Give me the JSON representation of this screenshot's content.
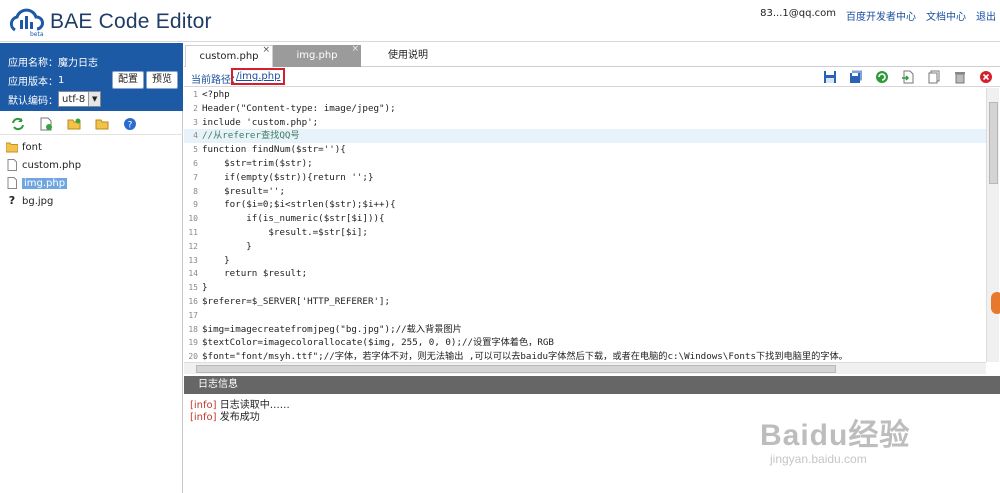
{
  "header": {
    "brand": "BAE Code Editor",
    "logo_tag": "beta",
    "user": "83...1@qq.com",
    "links": [
      "百度开发者中心",
      "文档中心",
      "退出"
    ]
  },
  "app": {
    "name_label": "应用名称：",
    "name_value": "魔力日志",
    "version_label": "应用版本：",
    "version_value": "1",
    "encoding_label": "默认编码：",
    "encoding_value": "utf-8",
    "config_button": "配置",
    "preview_button": "预览"
  },
  "file_tools": [
    "refresh-icon",
    "new-file-icon",
    "new-folder-icon",
    "open-folder-icon",
    "help-icon"
  ],
  "tree": [
    {
      "name": "font",
      "type": "folder"
    },
    {
      "name": "custom.php",
      "type": "file"
    },
    {
      "name": "img.php",
      "type": "file",
      "selected": true
    },
    {
      "name": "bg.jpg",
      "type": "unknown"
    }
  ],
  "tabs": [
    {
      "label": "custom.php"
    },
    {
      "label": "img.php"
    },
    {
      "label": "使用说明"
    }
  ],
  "path": {
    "label": "当前路径：",
    "value": "/img.php"
  },
  "path_tools": [
    "save-icon",
    "save-all-icon",
    "refresh-icon",
    "export-icon",
    "copy-icon",
    "delete-icon",
    "close-icon"
  ],
  "code": {
    "lines": [
      {
        "n": "1",
        "t": "<?php"
      },
      {
        "n": "2",
        "t": "Header(\"Content-type: image/jpeg\");"
      },
      {
        "n": "3",
        "t": "include 'custom.php';"
      },
      {
        "n": "4",
        "t": "//从referer查找QQ号"
      },
      {
        "n": "5",
        "t": "function findNum($str=''){"
      },
      {
        "n": "6",
        "t": "    $str=trim($str);"
      },
      {
        "n": "7",
        "t": "    if(empty($str)){return '';}"
      },
      {
        "n": "8",
        "t": "    $result='';"
      },
      {
        "n": "9",
        "t": "    for($i=0;$i<strlen($str);$i++){"
      },
      {
        "n": "10",
        "t": "        if(is_numeric($str[$i])){"
      },
      {
        "n": "11",
        "t": "            $result.=$str[$i];"
      },
      {
        "n": "12",
        "t": "        }"
      },
      {
        "n": "13",
        "t": "    }"
      },
      {
        "n": "14",
        "t": "    return $result;"
      },
      {
        "n": "15",
        "t": "}"
      },
      {
        "n": "16",
        "t": "$referer=$_SERVER['HTTP_REFERER'];"
      },
      {
        "n": "17",
        "t": ""
      },
      {
        "n": "18",
        "t": "$img=imagecreatefromjpeg(\"bg.jpg\");//载入背景图片"
      },
      {
        "n": "19",
        "t": "$textColor=imagecolorallocate($img, 255, 0, 0);//设置字体着色，RGB"
      },
      {
        "n": "20",
        "t": "$font=\"font/msyh.ttf\";//字体，若字体不对，则无法输出 ,可以可以去baidu字体然后下载，或者在电脑的c:\\Windows\\Fonts下找到电脑里的字体。"
      }
    ]
  },
  "log": {
    "title": "日志信息",
    "entries": [
      {
        "tag": "[info]",
        "text": "日志读取中……"
      },
      {
        "tag": "[info]",
        "text": "发布成功"
      }
    ]
  },
  "watermark": {
    "main": "Baidu经验",
    "sub": "jingyan.baidu.com"
  },
  "colors": {
    "accent": "#1d5aa6",
    "highlight_border": "#d4202a",
    "log_header": "#666666"
  }
}
